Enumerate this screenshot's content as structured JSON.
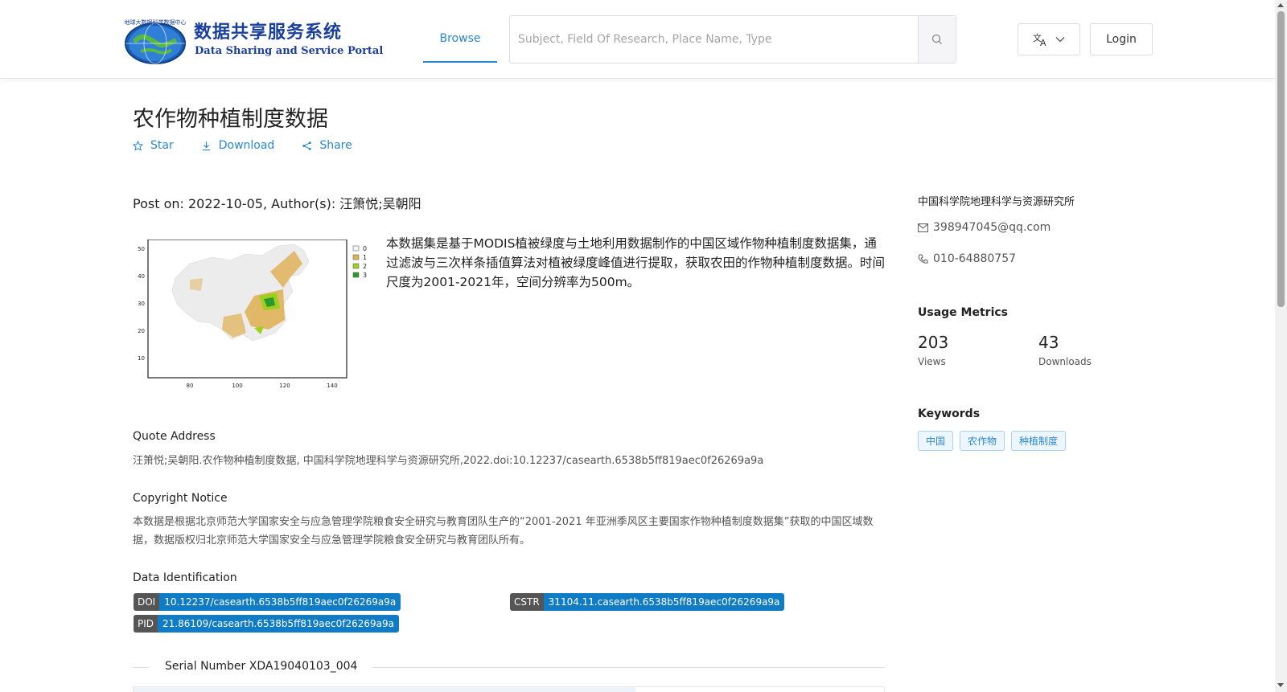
{
  "header": {
    "logo": {
      "title": "数据共享服务系统",
      "subtitle": "Data Sharing and Service Portal",
      "emblem_text": "地球大数据科学数据中心"
    },
    "nav": {
      "browse_label": "Browse"
    },
    "search": {
      "placeholder": "Subject, Field Of Research, Place Name, Type",
      "icon": "search-icon"
    },
    "language_icon": "translate-icon",
    "login_label": "Login"
  },
  "dataset": {
    "title": "农作物种植制度数据",
    "actions": {
      "star": "Star",
      "download": "Download",
      "share": "Share"
    },
    "meta": "Post on: 2022-10-05, Author(s): 汪箫悦;吴朝阳",
    "description": "本数据集是基于MODIS植被绿度与土地利用数据制作的中国区域作物种植制度数据集，通过滤波与三次样条插值算法对植被绿度峰值进行提取，获取农田的作物种植制度数据。时间尺度为2001-2021年，空间分辨率为500m。",
    "map": {
      "legend": [
        "0",
        "1",
        "2",
        "3"
      ],
      "legend_colors": [
        "#f4f4f4",
        "#e0b35a",
        "#9ecf1f",
        "#2e9a2e"
      ],
      "x_ticks": [
        "80",
        "100",
        "120",
        "140"
      ],
      "y_ticks": [
        "50",
        "40",
        "30",
        "20",
        "10"
      ]
    },
    "quote": {
      "title": "Quote Address",
      "text": "汪箫悦;吴朝阳.农作物种植制度数据, 中国科学院地理科学与资源研究所,2022.doi:10.12237/casearth.6538b5ff819aec0f26269a9a"
    },
    "copyright": {
      "title": "Copyright Notice",
      "text": "本数据是根据北京师范大学国家安全与应急管理学院粮食安全研究与教育团队生产的“2001-2021 年亚洲季风区主要国家作物种植制度数据集”获取的中国区域数据，数据版权归北京师范大学国家安全与应急管理学院粮食安全研究与教育团队所有。"
    },
    "identification": {
      "title": "Data Identification",
      "doi_key": "DOI",
      "doi_value": "10.12237/casearth.6538b5ff819aec0f26269a9a",
      "cstr_key": "CSTR",
      "cstr_value": "31104.11.casearth.6538b5ff819aec0f26269a9a",
      "pid_key": "PID",
      "pid_value": "21.86109/casearth.6538b5ff819aec0f26269a9a"
    },
    "serial": "Serial Number XDA19040103_004"
  },
  "sidebar": {
    "organization": "中国科学院地理科学与资源研究所",
    "email": "398947045@qq.com",
    "phone": "010-64880757",
    "metrics": {
      "title": "Usage Metrics",
      "views_value": "203",
      "views_label": "Views",
      "downloads_value": "43",
      "downloads_label": "Downloads"
    },
    "keywords": {
      "title": "Keywords",
      "items": [
        "中国",
        "农作物",
        "种植制度"
      ]
    }
  },
  "colors": {
    "accent": "#2a87d0",
    "badge_key": "#555555",
    "badge_value": "#0f7cc5"
  }
}
